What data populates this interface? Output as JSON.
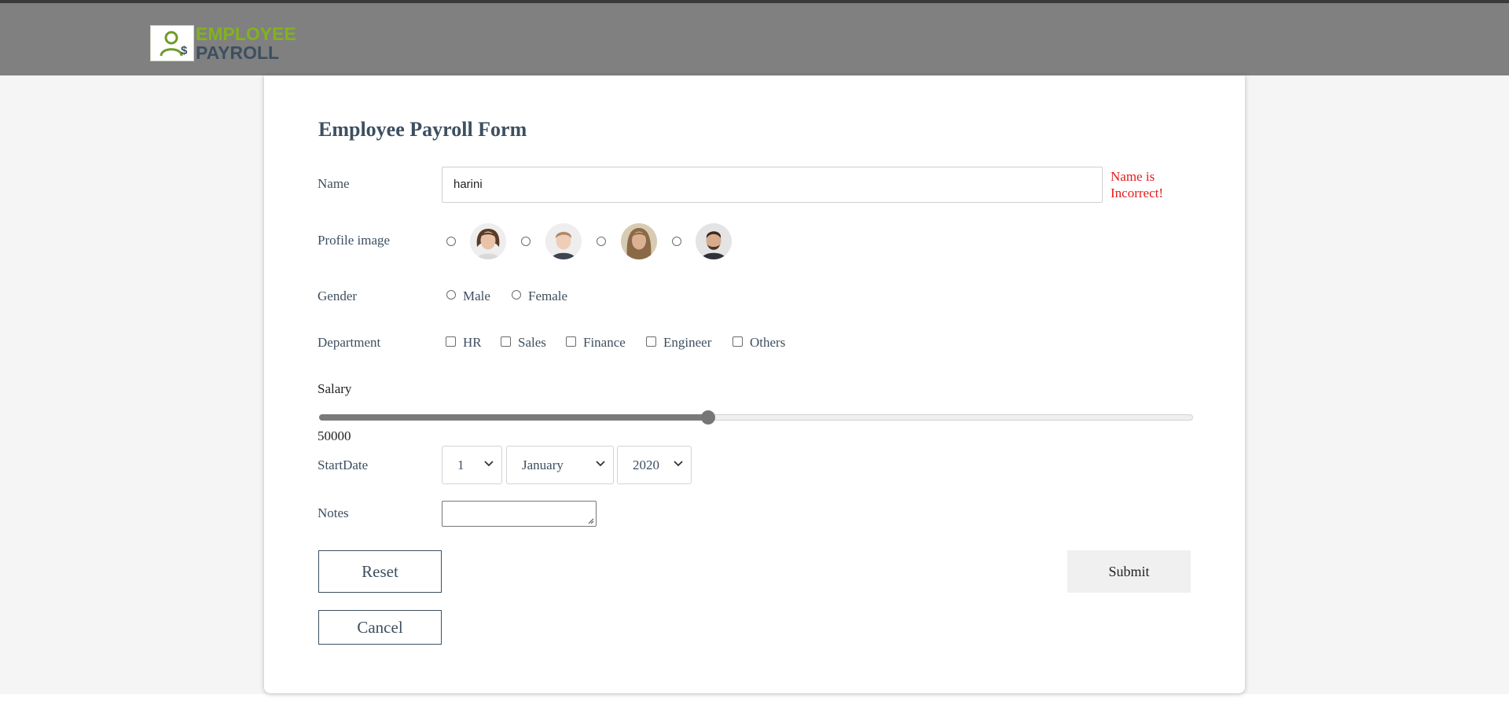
{
  "header": {
    "logo_line1": "EMPLOYEE",
    "logo_line2": "PAYROLL",
    "logo_icon": "user-dollar-icon"
  },
  "form": {
    "title": "Employee Payroll Form",
    "name": {
      "label": "Name",
      "value": "harini",
      "error": "Name is Incorrect!"
    },
    "profile_image": {
      "label": "Profile image",
      "options": [
        {
          "icon": "female-avatar-1"
        },
        {
          "icon": "male-avatar-1"
        },
        {
          "icon": "female-avatar-2"
        },
        {
          "icon": "male-avatar-2"
        }
      ]
    },
    "gender": {
      "label": "Gender",
      "options": [
        "Male",
        "Female"
      ]
    },
    "department": {
      "label": "Department",
      "options": [
        "HR",
        "Sales",
        "Finance",
        "Engineer",
        "Others"
      ]
    },
    "salary": {
      "label": "Salary",
      "value": "50000",
      "slider_fraction": 0.445
    },
    "start_date": {
      "label": "StartDate",
      "day": "1",
      "month": "January",
      "year": "2020"
    },
    "notes": {
      "label": "Notes",
      "value": ""
    },
    "buttons": {
      "reset": "Reset",
      "submit": "Submit",
      "cancel": "Cancel"
    }
  },
  "colors": {
    "header_bg": "#808080",
    "logo_green": "#82b21e",
    "logo_navy": "#3d4f60",
    "label": "#3d4f60",
    "error": "#e31b1b"
  }
}
